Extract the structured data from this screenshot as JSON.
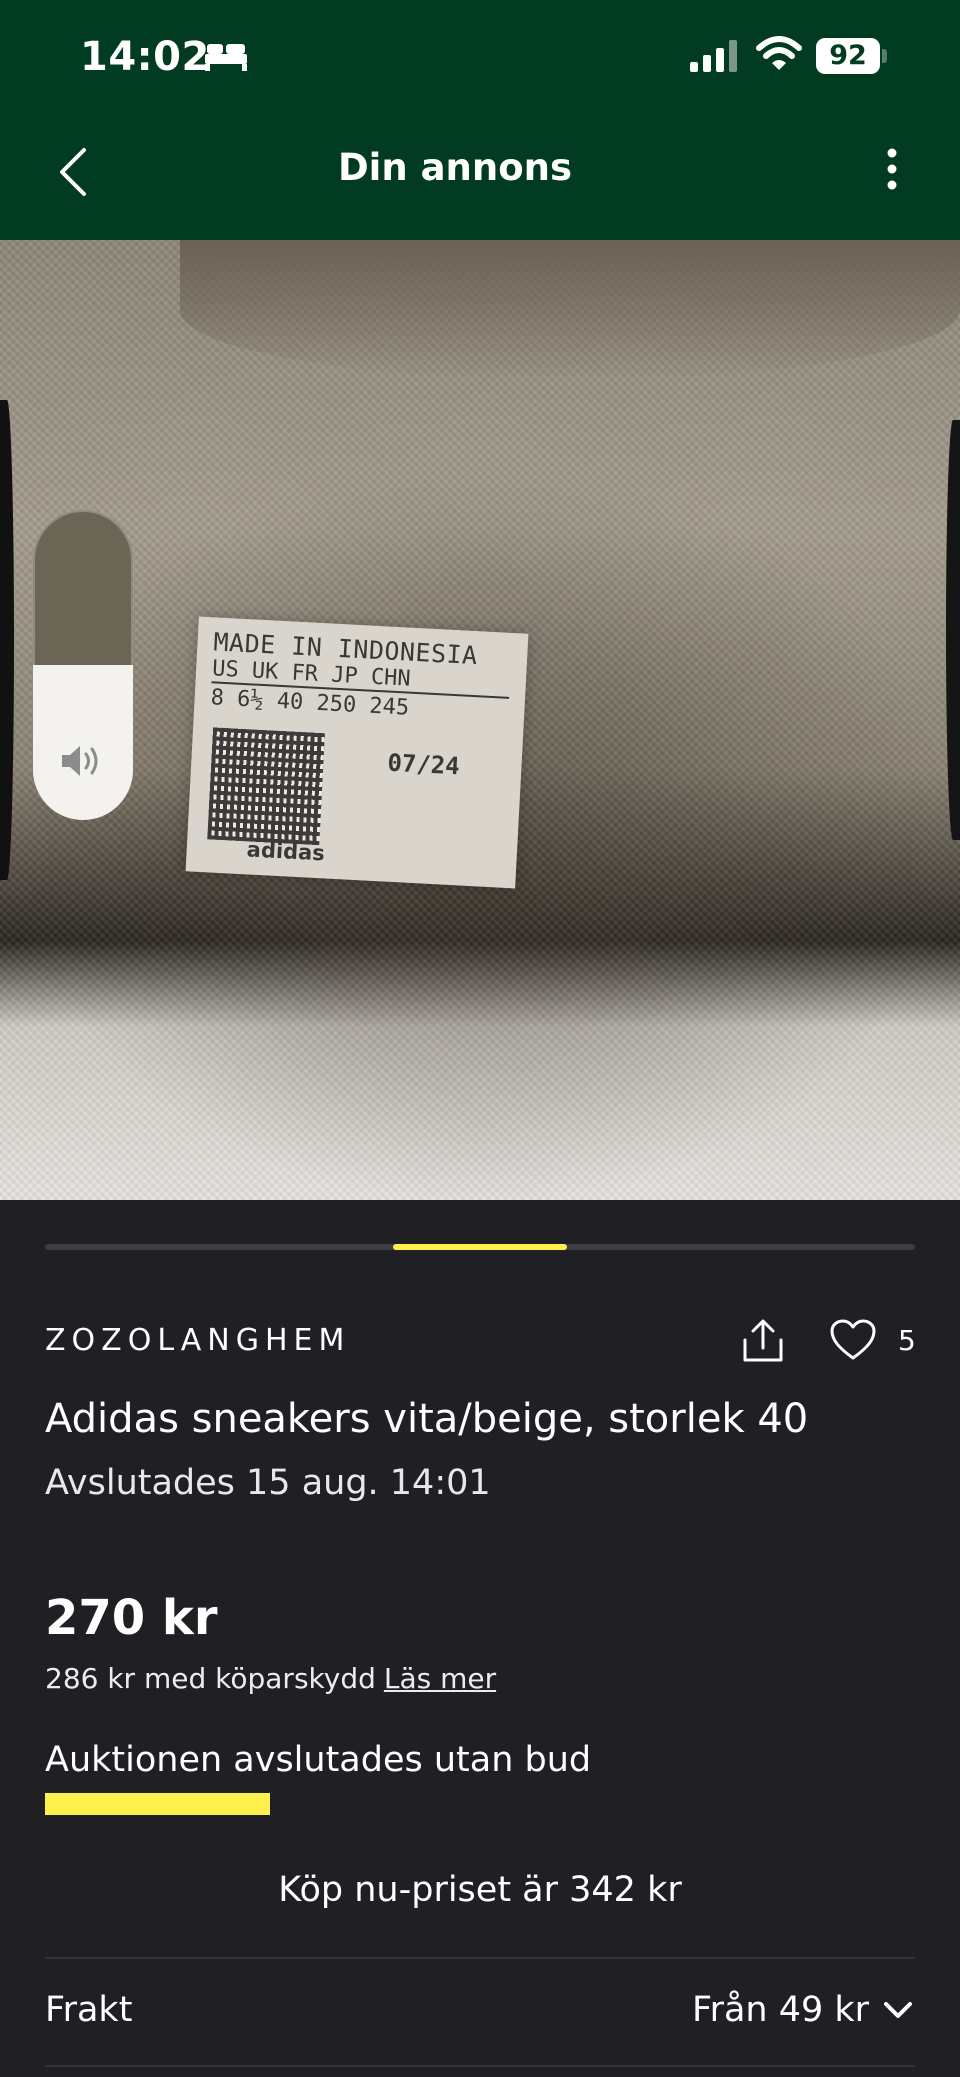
{
  "status_bar": {
    "time": "14:02",
    "battery": "92",
    "icons": [
      "bed-icon",
      "signal-icon",
      "wifi-icon",
      "battery-icon"
    ]
  },
  "nav": {
    "title": "Din annons",
    "back_icon": "chevron-left-icon",
    "more_icon": "more-vertical-icon"
  },
  "photo": {
    "label_lines": [
      "MADE IN INDONESIA",
      "US  UK  FR  JP  CHN",
      "8  6½  40  250 245"
    ],
    "label_date": "07/24",
    "label_brand": "adidas",
    "volume_level": 0.5,
    "volume_icon": "speaker-icon"
  },
  "gallery": {
    "current_index": 3,
    "total": 5
  },
  "listing": {
    "seller": "ZOZOLANGHEM",
    "favorites_count": "5",
    "title": "Adidas sneakers vita/beige, storlek 40",
    "ended": "Avslutades 15 aug. 14:01",
    "price": "270 kr",
    "protection_text": "286 kr med köparskydd",
    "protection_link": "Läs mer",
    "auction_status": "Auktionen avslutades utan bud",
    "buy_now": "Köp nu-priset är 342 kr"
  },
  "shipping": {
    "label": "Frakt",
    "value": "Från 49 kr"
  },
  "colors": {
    "header_green": "#003b22",
    "background": "#1f1f24",
    "accent_yellow": "#fdf04d"
  }
}
